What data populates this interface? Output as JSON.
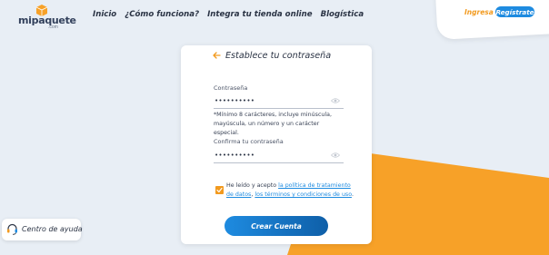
{
  "logo": {
    "brand": "mipaquete",
    "suffix": ".com"
  },
  "nav": [
    "Inicio",
    "¿Cómo funciona?",
    "Integra tu tienda online",
    "Blogística"
  ],
  "auth": {
    "login": "Ingresa",
    "register": "Regístrate"
  },
  "form": {
    "title": "Establece tu contraseña",
    "password": {
      "label": "Contraseña",
      "value": "••••••••••"
    },
    "hint": "*Mínimo 8 carácteres, incluye minúscula, mayúscula, un número y un carácter especial.",
    "confirm": {
      "label": "Confirma tu contraseña",
      "value": "••••••••••"
    },
    "consent": {
      "prefix": "He leído y acepto ",
      "link1": "la política de tratamiento de datos",
      "sep": ", ",
      "link2": "los términos y condiciones de uso",
      "suffix": ".",
      "checked": true
    },
    "submit": "Crear Cuenta"
  },
  "help": {
    "label": "Centro de ayuda"
  },
  "colors": {
    "accent": "#f29a1f",
    "primary": "#1e8be0",
    "background": "#e8eef5"
  },
  "icons": [
    "box-icon",
    "back-arrow-icon",
    "eye-icon",
    "check-icon",
    "headset-icon"
  ]
}
